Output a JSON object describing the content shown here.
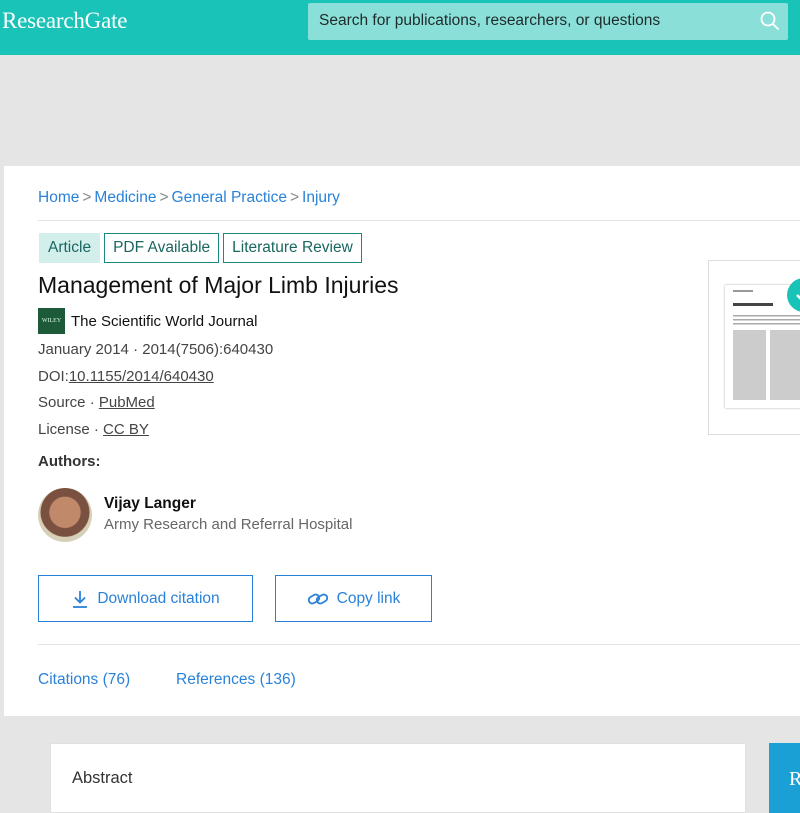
{
  "header": {
    "logo": "ResearchGate",
    "search_placeholder": "Search for publications, researchers, or questions",
    "accent_color": "#19c3b7"
  },
  "breadcrumb": [
    "Home",
    "Medicine",
    "General Practice",
    "Injury"
  ],
  "badges": [
    "Article",
    "PDF Available",
    "Literature Review"
  ],
  "publication": {
    "title": "Management of Major Limb Injuries",
    "journal_logo_text": "WILEY",
    "journal": "The Scientific World Journal",
    "date_volume": "January 2014 · 2014(7506):640430",
    "doi_label": "DOI:",
    "doi": "10.1155/2014/640430",
    "source_label": "Source · ",
    "source": "PubMed",
    "license_label": "License · ",
    "license": "CC BY"
  },
  "authors": {
    "label": "Authors:",
    "list": [
      {
        "name": "Vijay Langer",
        "institution": "Army Research and Referral Hospital"
      }
    ]
  },
  "actions": {
    "download_citation": "Download citation",
    "copy_link": "Copy link"
  },
  "tabs": {
    "citations": "Citations (76)",
    "references": "References (136)"
  },
  "abstract": {
    "label": "Abstract"
  },
  "side_panel": {
    "letter": "R"
  }
}
